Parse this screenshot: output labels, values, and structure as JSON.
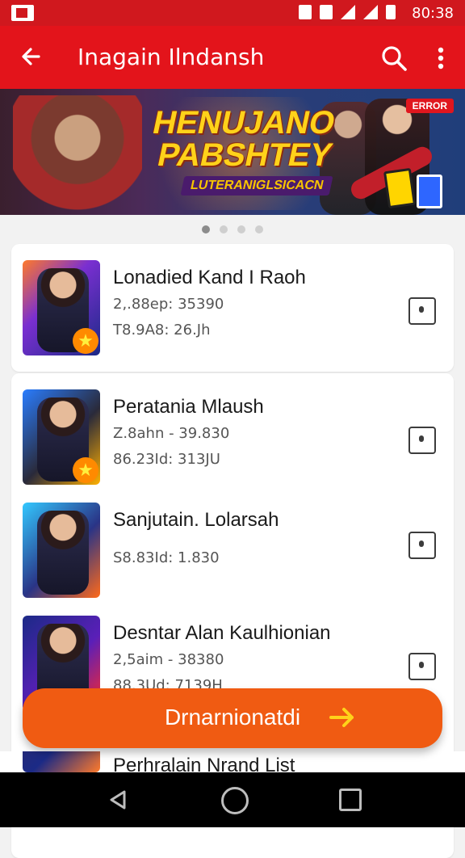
{
  "status": {
    "time": "80:38"
  },
  "appbar": {
    "title": "Inagain Ilndansh",
    "back_icon": "arrow-left-icon",
    "search_icon": "search-icon",
    "menu_icon": "more-vert-icon"
  },
  "banner": {
    "title_line1": "HENUJANO",
    "title_line2": "PABSHTEY",
    "subtitle": "LUTERANIGLSICACN",
    "badge": "ERROR",
    "page_indicator": {
      "count": 4,
      "active_index": 0
    }
  },
  "items": [
    {
      "title": "Lonadied Kand I Raoh",
      "meta1": "2,.88ep: 35390",
      "meta2": "T8.9A8: 26.Jh"
    },
    {
      "title": "Peratania Mlaush",
      "meta1": "Z.8ahn - 39.830",
      "meta2": "86.23Id: 313JU"
    },
    {
      "title": "Sanjutain. Lolarsah",
      "meta1": "",
      "meta2": "S8.83Id: 1.830"
    },
    {
      "title": "Desntar Alan Kaulhionian",
      "meta1": "2,5aim - 38380",
      "meta2": "88.3Ud: 7139H"
    },
    {
      "title": "Perhralain Nrand List",
      "meta1": "",
      "meta2": ""
    }
  ],
  "cta": {
    "label": "Drnarnionatdi",
    "arrow_icon": "arrow-right-icon",
    "accent": "#f05b12"
  },
  "colors": {
    "primary": "#e3141b",
    "status": "#d0181e"
  },
  "navbar": {
    "back_icon": "back-triangle-icon",
    "home_icon": "home-circle-icon",
    "recents_icon": "recents-square-icon"
  }
}
